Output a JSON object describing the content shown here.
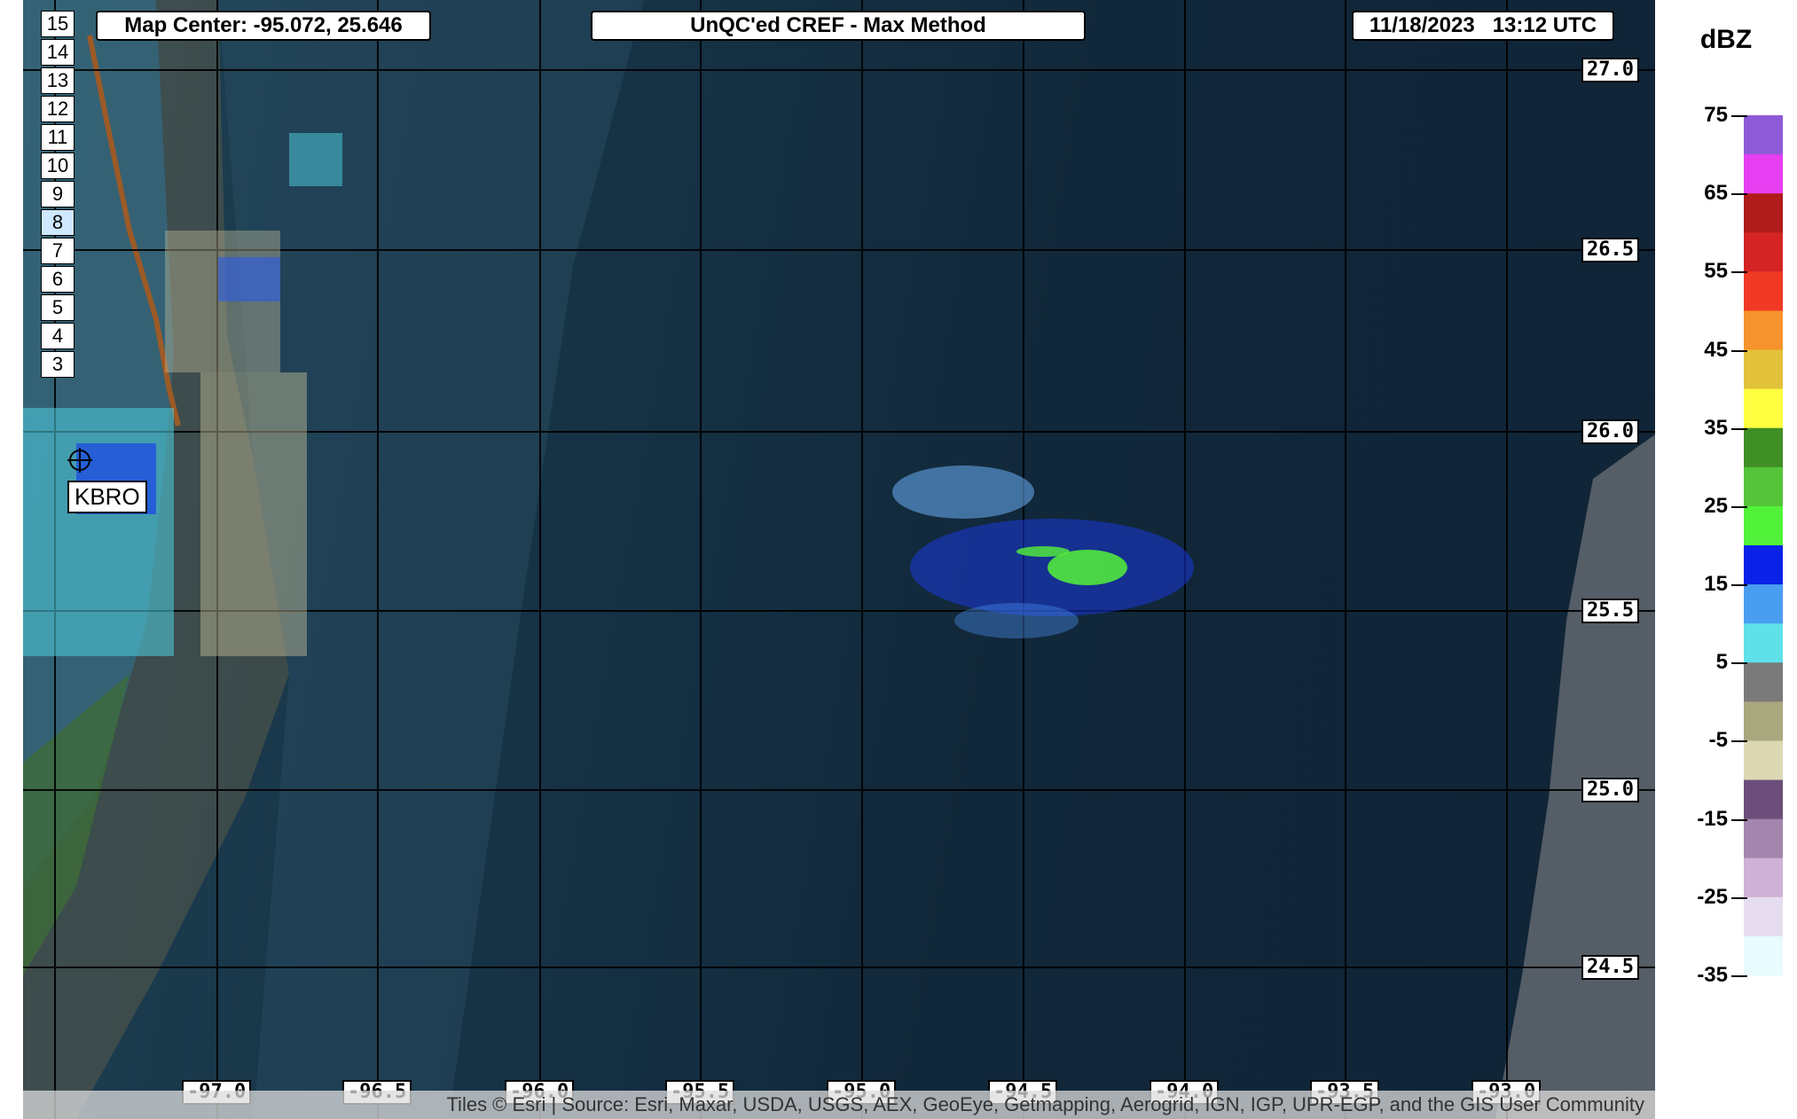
{
  "map": {
    "center_label": "Map Center: -95.072, 25.646",
    "product_title": "UnQC'ed CREF - Max Method",
    "timestamp": "11/18/2023   13:12 UTC",
    "station": "KBRO",
    "attribution": "Tiles © Esri | Source: Esri, Maxar, USDA, USGS, AEX, GeoEye, Getmapping, Aerogrid, IGN, IGP, UPR-EGP, and the GIS User Community",
    "zoom_levels": [
      "15",
      "14",
      "13",
      "12",
      "11",
      "10",
      "9",
      "8",
      "7",
      "6",
      "5",
      "4",
      "3"
    ],
    "active_zoom": "8",
    "lat_labels": [
      "27.0",
      "26.5",
      "26.0",
      "25.5",
      "25.0",
      "24.5"
    ],
    "lon_labels": [
      "-97.0",
      "-96.5",
      "-96.0",
      "-95.5",
      "-95.0",
      "-94.5",
      "-94.0",
      "-93.5",
      "-93.0"
    ]
  },
  "legend": {
    "title": "dBZ",
    "ticks": [
      "75",
      "65",
      "55",
      "45",
      "35",
      "25",
      "15",
      "5",
      "-5",
      "-15",
      "-25",
      "-35"
    ],
    "colors": [
      "#8e5bd6",
      "#e63ef0",
      "#b01c1c",
      "#d42424",
      "#f03a26",
      "#f7932c",
      "#e2c23a",
      "#ffff40",
      "#3f8f24",
      "#55c43a",
      "#52f23a",
      "#0a22e8",
      "#4a9ef0",
      "#60e0e8",
      "#7a7a7a",
      "#a9a77e",
      "#ddd8b4",
      "#6b4f7a",
      "#a286ad",
      "#cfb0d6",
      "#e6dcef",
      "#e8fbff"
    ]
  }
}
